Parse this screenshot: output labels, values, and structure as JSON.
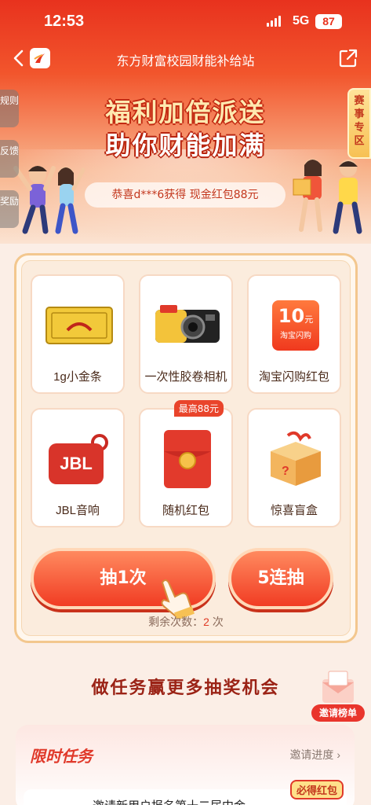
{
  "status_bar": {
    "time": "12:53",
    "network": "5G",
    "battery": "87"
  },
  "nav": {
    "title": "东方财富校园财能补给站"
  },
  "side_tabs": [
    "规则",
    "反馈",
    "奖励"
  ],
  "season_tab": "赛事专区",
  "hero": {
    "slogan_line1": "福利加倍派送",
    "slogan_line2": "助你财能加满",
    "ticker": "恭喜d***6获得 现金红包88元"
  },
  "prizes": [
    {
      "label": "1g小金条",
      "icon": "gold-bar-icon",
      "badge": ""
    },
    {
      "label": "一次性胶卷相机",
      "icon": "film-camera-icon",
      "badge": ""
    },
    {
      "label": "淘宝闪购红包",
      "icon": "taobao-coupon-icon",
      "badge": "",
      "coupon_value": "10",
      "coupon_unit": "元",
      "coupon_sub": "淘宝闪购"
    },
    {
      "label": "JBL音响",
      "icon": "jbl-speaker-icon",
      "badge": "",
      "brand": "JBL"
    },
    {
      "label": "随机红包",
      "icon": "red-envelope-icon",
      "badge": "最高88元"
    },
    {
      "label": "惊喜盲盒",
      "icon": "mystery-box-icon",
      "badge": ""
    }
  ],
  "draw": {
    "single_label": "抽1次",
    "multi_label": "5连抽",
    "remaining_prefix": "剩余次数：",
    "remaining_count": "2",
    "remaining_suffix": " 次"
  },
  "tasks": {
    "heading": "做任务赢更多抽奖机会",
    "invite_rank_label": "邀请榜单",
    "card_title": "限时任务",
    "invite_progress": "邀请进度",
    "item_text": "邀请新用户报名第十二届中金",
    "item_badge": "必得红包"
  },
  "colors": {
    "brand_red": "#e8321e",
    "panel_bg": "#fbecdd",
    "button_red": "#f13c23"
  }
}
